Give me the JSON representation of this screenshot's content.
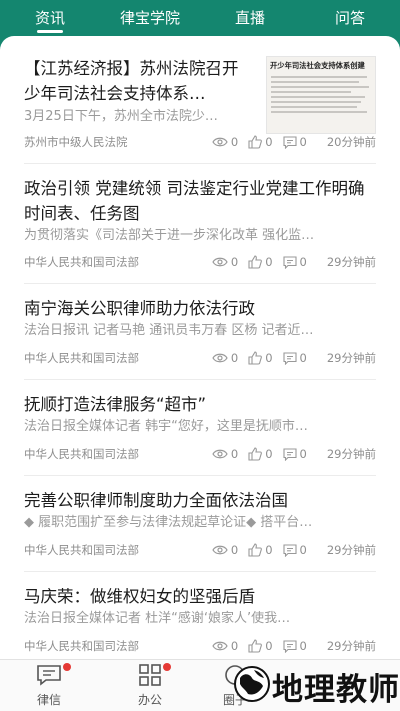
{
  "tabs": [
    "资讯",
    "律宝学院",
    "直播",
    "问答"
  ],
  "articles": [
    {
      "title": "【江苏经济报】苏州法院召开少年司法社会支持体系…",
      "summary": "3月25日下午，苏州全市法院少…",
      "source": "苏州市中级人民法院",
      "views": "0",
      "likes": "0",
      "comments": "0",
      "time": "20分钟前",
      "thumbnail_headline": "开少年司法社会支持体系创建"
    },
    {
      "title": "政治引领 党建统领 司法鉴定行业党建工作明确时间表、任务图",
      "summary": "为贯彻落实《司法部关于进一步深化改革 强化监…",
      "source": "中华人民共和国司法部",
      "views": "0",
      "likes": "0",
      "comments": "0",
      "time": "29分钟前"
    },
    {
      "title": "南宁海关公职律师助力依法行政",
      "summary": "法治日报讯 记者马艳 通讯员韦万春 区杨 记者近…",
      "source": "中华人民共和国司法部",
      "views": "0",
      "likes": "0",
      "comments": "0",
      "time": "29分钟前"
    },
    {
      "title": "抚顺打造法律服务“超市”",
      "summary": "法治日报全媒体记者 韩宇“您好，这里是抚顺市…",
      "source": "中华人民共和国司法部",
      "views": "0",
      "likes": "0",
      "comments": "0",
      "time": "29分钟前"
    },
    {
      "title": "完善公职律师制度助力全面依法治国",
      "summary": "◆ 履职范围扩至参与法律法规起草论证◆ 搭平台…",
      "source": "中华人民共和国司法部",
      "views": "0",
      "likes": "0",
      "comments": "0",
      "time": "29分钟前"
    },
    {
      "title": "马庆荣：做维权妇女的坚强后盾",
      "summary": "法治日报全媒体记者 杜洋“感谢‘娘家人’使我…",
      "source": "中华人民共和国司法部",
      "views": "0",
      "likes": "0",
      "comments": "0",
      "time": "29分钟前"
    }
  ],
  "bottom_nav": [
    "律信",
    "办公",
    "圈子"
  ],
  "watermark": "地理教师",
  "icons": [
    "eye-icon",
    "thumbs-up-icon",
    "comment-icon",
    "chat-icon",
    "apps-icon",
    "circle-icon"
  ],
  "colors": {
    "brand": "#14866f",
    "badge": "#e53935"
  }
}
